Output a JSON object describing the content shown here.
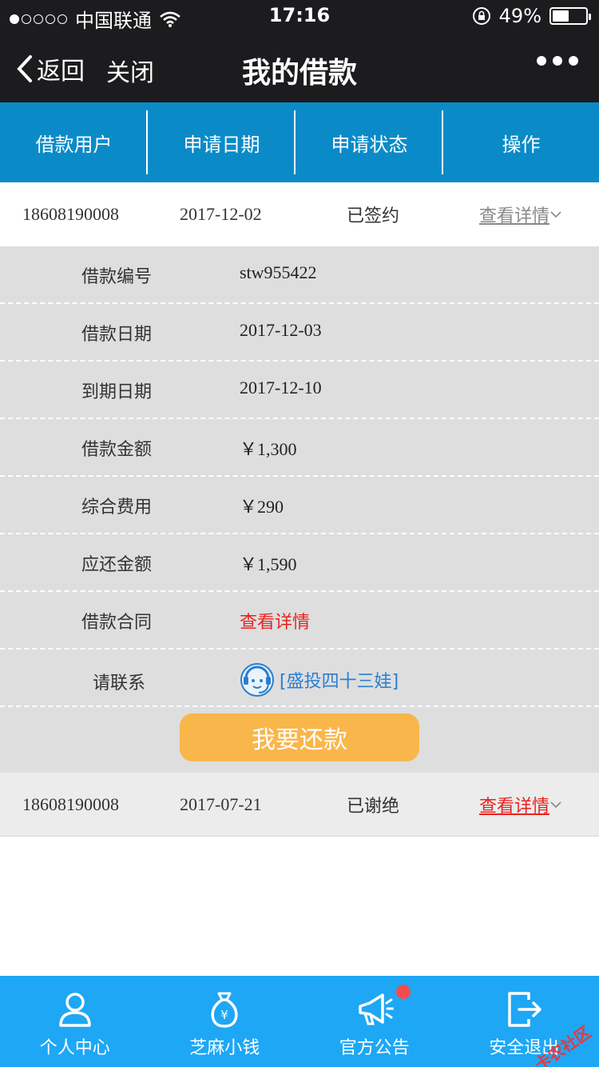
{
  "statusbar": {
    "carrier": "中国联通",
    "time": "17:16",
    "battery": "49%",
    "battery_level": 0.49
  },
  "navbar": {
    "back_label": "返回",
    "close_label": "关闭",
    "title": "我的借款"
  },
  "table": {
    "headers": [
      "借款用户",
      "申请日期",
      "申请状态",
      "操作"
    ],
    "rows": [
      {
        "user": "18608190008",
        "date": "2017-12-02",
        "status": "已签约",
        "action": "查看详情"
      },
      {
        "user": "18608190008",
        "date": "2017-07-21",
        "status": "已谢绝",
        "action": "查看详情"
      }
    ]
  },
  "details": {
    "items": [
      {
        "label": "借款编号",
        "value": "stw955422"
      },
      {
        "label": "借款日期",
        "value": "2017-12-03"
      },
      {
        "label": "到期日期",
        "value": "2017-12-10"
      },
      {
        "label": "借款金额",
        "value": "￥1,300"
      },
      {
        "label": "综合费用",
        "value": "￥290"
      },
      {
        "label": "应还金额",
        "value": "￥1,590"
      },
      {
        "label": "借款合同",
        "value": "查看详情"
      }
    ],
    "contact_label": "请联系",
    "contact_name": "[盛投四十三娃]",
    "pay_button": "我要还款"
  },
  "tabs": [
    {
      "label": "个人中心",
      "icon": "person-icon"
    },
    {
      "label": "芝麻小钱",
      "icon": "money-bag-icon"
    },
    {
      "label": "官方公告",
      "icon": "megaphone-icon"
    },
    {
      "label": "安全退出",
      "icon": "logout-icon"
    }
  ],
  "watermark": "卡农社区",
  "colors": {
    "header_blue": "#0a8bc8",
    "tab_blue": "#1ea7f5",
    "pay_orange": "#f9b64b",
    "link_red": "#e8231f"
  }
}
